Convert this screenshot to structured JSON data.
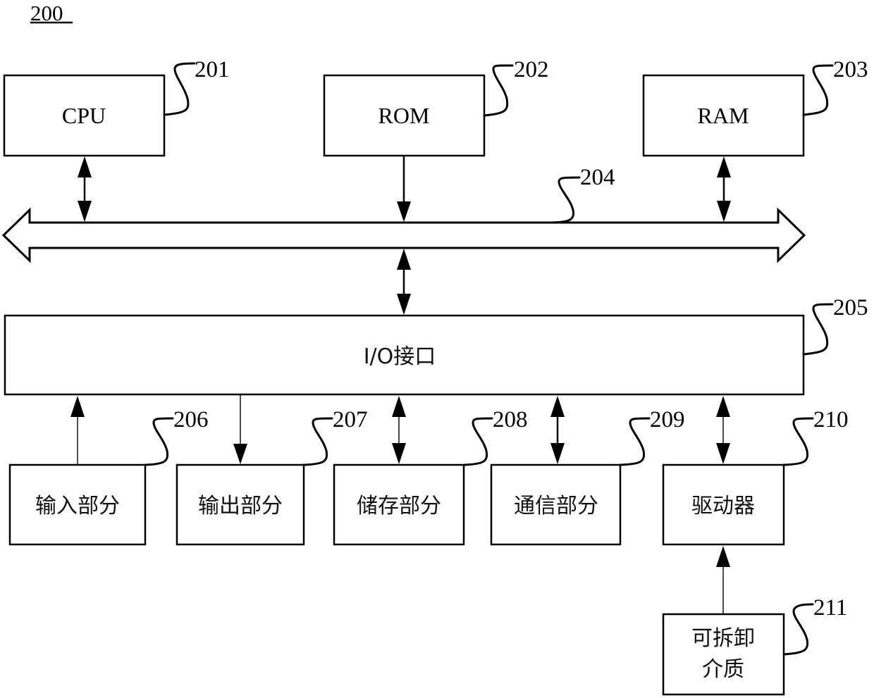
{
  "figure": {
    "number": "200"
  },
  "components": {
    "cpu": {
      "label": "CPU",
      "ref": "201"
    },
    "rom": {
      "label": "ROM",
      "ref": "202"
    },
    "ram": {
      "label": "RAM",
      "ref": "203"
    },
    "bus": {
      "ref": "204"
    },
    "io_interface": {
      "label": "I/O接口",
      "ref": "205"
    },
    "input_part": {
      "label": "输入部分",
      "ref": "206"
    },
    "output_part": {
      "label": "输出部分",
      "ref": "207"
    },
    "storage_part": {
      "label": "储存部分",
      "ref": "208"
    },
    "communication_part": {
      "label": "通信部分",
      "ref": "209"
    },
    "driver": {
      "label": "驱动器",
      "ref": "210"
    },
    "removable_media": {
      "label_line1": "可拆卸",
      "label_line2": "介质",
      "ref": "211"
    }
  },
  "connections": [
    {
      "from": "cpu",
      "to": "bus",
      "direction": "bidirectional"
    },
    {
      "from": "rom",
      "to": "bus",
      "direction": "one-way"
    },
    {
      "from": "ram",
      "to": "bus",
      "direction": "bidirectional"
    },
    {
      "from": "bus",
      "to": "io_interface",
      "direction": "bidirectional"
    },
    {
      "from": "input_part",
      "to": "io_interface",
      "direction": "one-way"
    },
    {
      "from": "io_interface",
      "to": "output_part",
      "direction": "one-way"
    },
    {
      "from": "storage_part",
      "to": "io_interface",
      "direction": "bidirectional"
    },
    {
      "from": "communication_part",
      "to": "io_interface",
      "direction": "bidirectional"
    },
    {
      "from": "driver",
      "to": "io_interface",
      "direction": "bidirectional"
    },
    {
      "from": "removable_media",
      "to": "driver",
      "direction": "one-way"
    }
  ]
}
